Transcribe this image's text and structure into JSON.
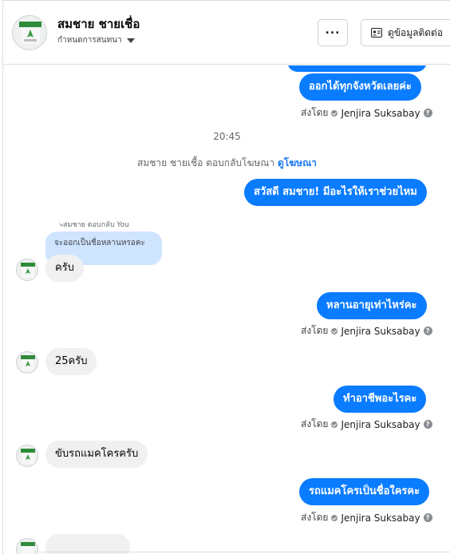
{
  "header": {
    "contact_name": "สมชาย ชายเชื่อ",
    "stage_label": "กำหนดการสนทนา",
    "contact_info_label": "ดูข้อมูลติดต่อ"
  },
  "messages": {
    "m1": "ออกได้ทุกจังหวัดเลยค่ะ",
    "sent_by_1": "ส่งโดย",
    "agent_1": "Jenjira Suksabay",
    "time": "20:45",
    "system_text": "สมชาย ชายเชื้อ ตอบกลับโฆษณา",
    "system_link": "ดูโฆษณา",
    "m2": "สวัสดี สมชาย! มีอะไรให้เราช่วยไหม",
    "reply_label": "สมชาย ตอบกลับ You",
    "quote_text": "จะออกเป็นชื่อหลานหรอคะ",
    "m3": "ครับ",
    "m4": "หลานอายุเท่าไหร่คะ",
    "sent_by_2": "ส่งโดย",
    "agent_2": "Jenjira Suksabay",
    "m5": "25ครับ",
    "m6": "ทำอาชีพอะไรคะ",
    "sent_by_3": "ส่งโดย",
    "agent_3": "Jenjira Suksabay",
    "m7": "ขับรถแมคโครครับ",
    "m8": "รถแมคโครเป็นชื่อใครคะ",
    "sent_by_4": "ส่งโดย",
    "agent_4": "Jenjira Suksabay"
  },
  "icons": {
    "more": "more-horizontal-icon",
    "contact": "contact-card-icon",
    "verified": "check-circle-icon",
    "help": "question-icon"
  },
  "colors": {
    "outgoing_bubble": "#0a7cff",
    "incoming_bubble": "#f0f0f0",
    "quote_bubble": "#cfe4ff",
    "link": "#1877f2"
  }
}
